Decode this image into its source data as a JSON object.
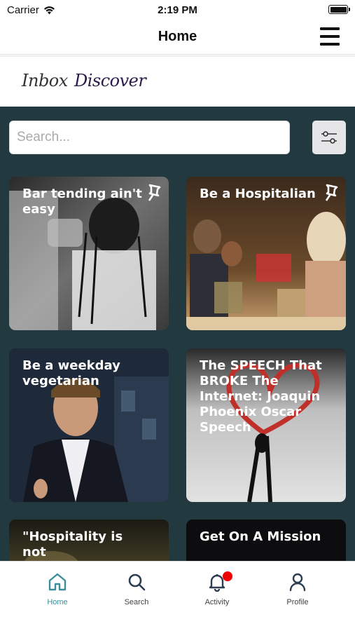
{
  "status_bar": {
    "carrier": "Carrier",
    "time": "2:19 PM"
  },
  "header": {
    "title": "Home"
  },
  "subtabs": {
    "inbox": "Inbox",
    "discover": "Discover"
  },
  "search": {
    "placeholder": "Search..."
  },
  "cards": [
    {
      "title": "Bar tending ain't easy",
      "pinned": true
    },
    {
      "title": "Be a Hospitalian",
      "pinned": true
    },
    {
      "title": "Be a weekday vegetarian",
      "pinned": false
    },
    {
      "title": "The SPEECH That BROKE The Internet: Joaquin Phoenix Oscar Speech",
      "pinned": false
    },
    {
      "title": "\"Hospitality is not Service......................it",
      "pinned": false
    },
    {
      "title": "Get On A Mission",
      "pinned": false
    }
  ],
  "tabbar": {
    "items": [
      {
        "label": "Home",
        "icon": "home-icon",
        "active": true
      },
      {
        "label": "Search",
        "icon": "search-icon",
        "active": false
      },
      {
        "label": "Activity",
        "icon": "bell-icon",
        "active": false,
        "badge": true
      },
      {
        "label": "Profile",
        "icon": "user-icon",
        "active": false
      }
    ]
  },
  "colors": {
    "background": "#21393f",
    "accent": "#3a8f9b",
    "badge": "#ee0000"
  }
}
